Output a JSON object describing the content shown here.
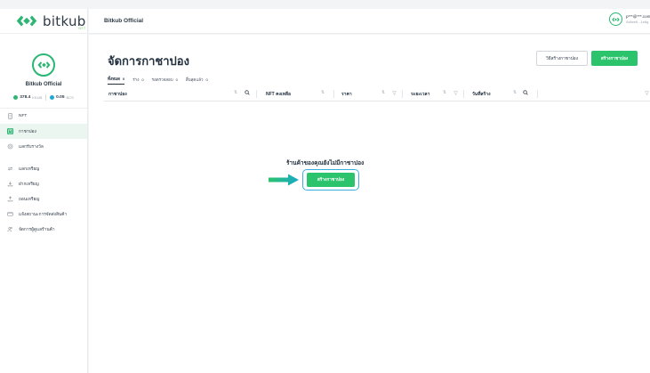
{
  "brand": {
    "name": "bitkub",
    "sub": "NFT"
  },
  "shop": {
    "name": "Bitkub Official",
    "balance_kub": {
      "value": "378.4",
      "unit": "KKUB"
    },
    "balance_bcs": {
      "value": "0.05",
      "unit": "BCS"
    }
  },
  "sidebar": {
    "items": [
      {
        "label": "NFT",
        "icon": "nft-icon"
      },
      {
        "label": "กาชาปอง",
        "icon": "gachapon-icon",
        "active": true
      },
      {
        "label": "แลกรับรางวัล",
        "icon": "reward-icon"
      },
      {
        "label": "แลกเหรียญ",
        "icon": "swap-icon"
      },
      {
        "label": "ฝากเหรียญ",
        "icon": "deposit-icon"
      },
      {
        "label": "ถอนเหรียญ",
        "icon": "withdraw-icon"
      },
      {
        "label": "แจ้งสถานะการจัดส่งสินค้า",
        "icon": "delivery-icon"
      },
      {
        "label": "จัดการผู้ดูแลร้านค้า",
        "icon": "admins-icon"
      }
    ]
  },
  "topbar": {
    "title": "Bitkub Official",
    "user_email": "p***@***.com",
    "user_address": "0x8ee6...1e6g"
  },
  "main": {
    "title": "จัดการกาชาปอง",
    "how_to_button": "วิธีสร้างกาชาปอง",
    "create_button": "สร้างกาชาปอง",
    "tabs": [
      {
        "label": "ทั้งหมด",
        "count": "0",
        "active": true
      },
      {
        "label": "ร่าง",
        "count": "0"
      },
      {
        "label": "รอตรวจสอบ",
        "count": "0"
      },
      {
        "label": "สิ้นสุดแล้ว",
        "count": "0"
      }
    ],
    "columns": [
      "กาชาปอง",
      "NFT คงเหลือ",
      "ราคา",
      "ระยะเวลา",
      "วันที่สร้าง"
    ],
    "empty_message": "ร้านค้าของคุณยังไม่มีกาชาปอง",
    "empty_cta": "สร้างกาชาปอง"
  },
  "colors": {
    "accent": "#2bc36b",
    "highlight_ring": "#3aaee0",
    "arrow": "#1fbf8f"
  }
}
